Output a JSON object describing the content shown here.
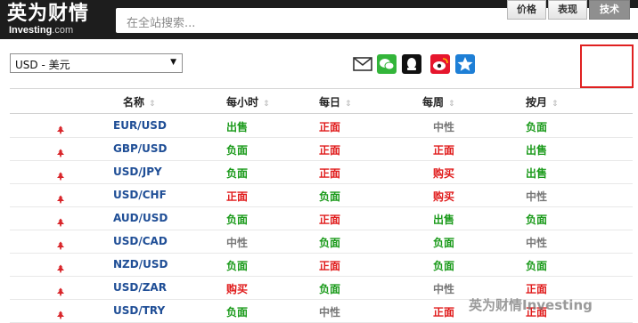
{
  "header": {
    "logo_cn": "英为财情",
    "logo_en": "Investing",
    "logo_domain": ".com",
    "search_placeholder": "在全站搜索..."
  },
  "currency_select": {
    "value": "USD - 美元"
  },
  "share_icons": [
    "mail-icon",
    "wechat-icon",
    "qq-icon",
    "weibo-icon",
    "star-bookmark-icon"
  ],
  "tabs": [
    {
      "label": "价格",
      "active": false
    },
    {
      "label": "表现",
      "active": false
    },
    {
      "label": "技术",
      "active": true
    }
  ],
  "table": {
    "headers": [
      "名称",
      "每小时",
      "每日",
      "每周",
      "按月"
    ],
    "rows": [
      {
        "pair": "EUR/USD",
        "signals": [
          "出售",
          "正面",
          "中性",
          "负面"
        ]
      },
      {
        "pair": "GBP/USD",
        "signals": [
          "负面",
          "正面",
          "正面",
          "出售"
        ]
      },
      {
        "pair": "USD/JPY",
        "signals": [
          "负面",
          "正面",
          "购买",
          "出售"
        ]
      },
      {
        "pair": "USD/CHF",
        "signals": [
          "正面",
          "负面",
          "购买",
          "中性"
        ]
      },
      {
        "pair": "AUD/USD",
        "signals": [
          "负面",
          "正面",
          "出售",
          "负面"
        ]
      },
      {
        "pair": "USD/CAD",
        "signals": [
          "中性",
          "负面",
          "负面",
          "中性"
        ]
      },
      {
        "pair": "NZD/USD",
        "signals": [
          "负面",
          "正面",
          "负面",
          "负面"
        ]
      },
      {
        "pair": "USD/ZAR",
        "signals": [
          "购买",
          "负面",
          "中性",
          "正面"
        ]
      },
      {
        "pair": "USD/TRY",
        "signals": [
          "负面",
          "中性",
          "正面",
          "正面"
        ]
      }
    ]
  },
  "signal_colors": {
    "出售": "#1a9a1a",
    "负面": "#1a9a1a",
    "正面": "#e01b1b",
    "购买": "#e01b1b",
    "中性": "#777777"
  },
  "watermark": "英为财情Investing"
}
